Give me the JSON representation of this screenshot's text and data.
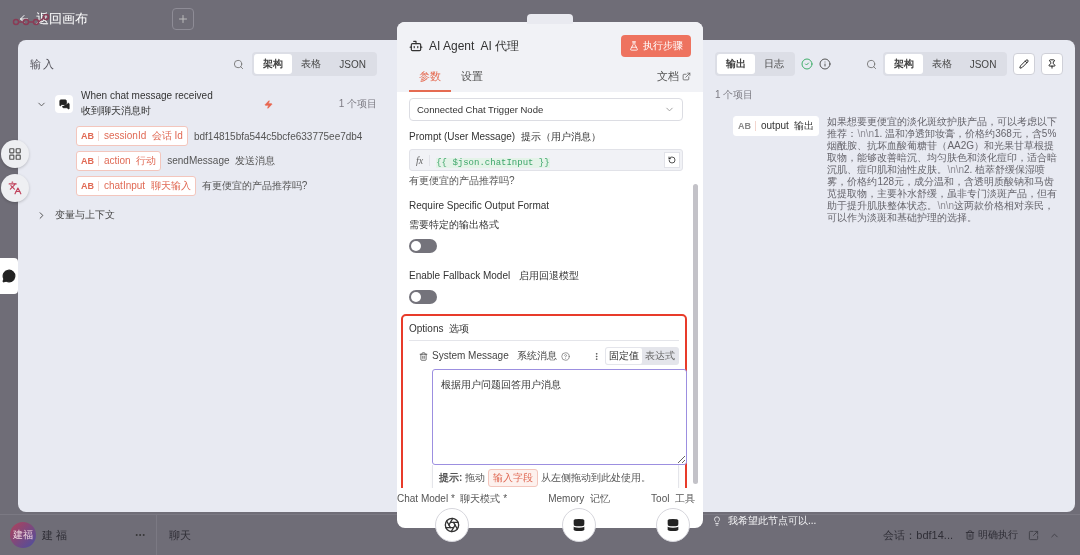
{
  "back_link": {
    "label": "返回画布"
  },
  "sidebar_user": {
    "avatar": "建福",
    "name": "建 福"
  },
  "canvas_bottom": {
    "chat_label": "聊天",
    "session": "会话：bdf14...",
    "hint": "我希望此节点可以...",
    "clear_button": "明确执行"
  },
  "input_panel": {
    "title": "输入",
    "view_tabs": [
      {
        "label": "架构",
        "selected": true
      },
      {
        "label": "表格",
        "selected": false
      },
      {
        "label": "JSON",
        "selected": false
      }
    ],
    "node": {
      "title": "When chat message received",
      "subtitle": "收到聊天消息时",
      "expanded": true,
      "count": "1 个项目",
      "fields": [
        {
          "type": "AB",
          "name": "sessionId",
          "label": "会话 Id",
          "value": "bdf14815bfa544c5bcfe633775ee7db4"
        },
        {
          "type": "AB",
          "name": "action",
          "label": "行动",
          "value": "sendMessage  发送消息"
        },
        {
          "type": "AB",
          "name": "chatInput",
          "label": "聊天输入",
          "value": "有更便宜的产品推荐吗?"
        }
      ]
    },
    "context": {
      "label": "变量与上下文",
      "expanded": false
    }
  },
  "node_panel": {
    "title": "AI Agent",
    "title_cn": "AI 代理",
    "run_button": "执行步骤",
    "tabs": [
      {
        "label": "参数",
        "selected": true
      },
      {
        "label": "设置",
        "selected": false
      }
    ],
    "docs_link": "文档",
    "source_select": "Connected Chat Trigger Node",
    "prompt": {
      "label": "Prompt (User Message)",
      "label_cn": "提示（用户消息）",
      "prefix": "fx",
      "expression": "{{ $json.chatInput }}",
      "preview": "有更便宜的产品推荐吗?"
    },
    "toggles": [
      {
        "label": "Require Specific Output Format",
        "sublabel": "需要特定的输出格式",
        "on": false
      },
      {
        "label": "Enable Fallback Model",
        "label_cn": "启用回退模型",
        "on": false
      }
    ],
    "options": {
      "title": "Options",
      "title_cn": "选项",
      "highlighted": true,
      "system_message": {
        "label": "System Message",
        "label_cn": "系统消息",
        "modes": [
          {
            "label": "固定值",
            "selected": true
          },
          {
            "label": "表达式",
            "selected": false
          }
        ],
        "value": "根据用户问题回答用户消息",
        "hint_prefix": "**提示:** 拖动",
        "hint_chip": "输入字段",
        "hint_suffix": "从左侧拖动到此处使用。"
      }
    },
    "connections": [
      {
        "label": "Chat Model *",
        "label_cn": "聊天模式 *",
        "kind": "ai"
      },
      {
        "label": "Memory",
        "label_cn": "记忆",
        "kind": "db"
      },
      {
        "label": "Tool",
        "label_cn": "工具",
        "kind": "db"
      }
    ]
  },
  "output_panel": {
    "tabs": [
      {
        "label": "输出",
        "selected": true
      },
      {
        "label": "日志",
        "selected": false
      }
    ],
    "success": true,
    "view_tabs": [
      {
        "label": "架构",
        "selected": true
      },
      {
        "label": "表格",
        "selected": false
      },
      {
        "label": "JSON",
        "selected": false
      }
    ],
    "count": "1 个项目",
    "field": {
      "type": "AB",
      "name": "output",
      "label": "输出",
      "parts": [
        {
          "kind": "text",
          "text": "如果想要更便宜的淡化斑纹护肤产品，可以考虑以下推荐："
        },
        {
          "kind": "escape",
          "text": "\\n\\n"
        },
        {
          "kind": "text",
          "text": "1. 温和净透卸妆膏，价格约368元，含5%烟酰胺、抗坏血酸葡糖苷（AA2G）和光果甘草根提取物，能够改善暗沉、均匀肤色和淡化痘印，适合暗沉肌、痘印肌和油性皮肤。"
        },
        {
          "kind": "escape",
          "text": "\\n\\n"
        },
        {
          "kind": "text",
          "text": "2. 植萃舒缓保湿喷雾，价格约128元，成分温和，含透明质酸钠和马齿苋提取物，主要补水舒缓，虽非专门淡斑产品，但有助于提升肌肤整体状态。"
        },
        {
          "kind": "escape",
          "text": "\\n\\n"
        },
        {
          "kind": "text",
          "text": "这两款价格相对亲民，可以作为淡斑和基础护理的选择。"
        }
      ]
    }
  }
}
